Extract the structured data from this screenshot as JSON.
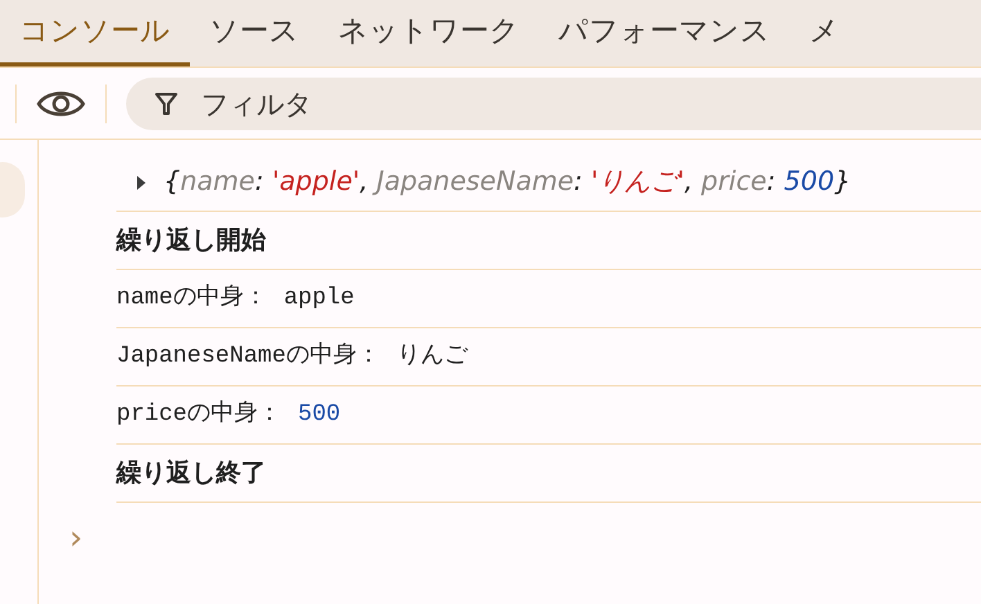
{
  "tabs": [
    {
      "label": "コンソール",
      "selected": true
    },
    {
      "label": "ソース",
      "selected": false
    },
    {
      "label": "ネットワーク",
      "selected": false
    },
    {
      "label": "パフォーマンス",
      "selected": false
    },
    {
      "label": "メ",
      "selected": false
    }
  ],
  "filter": {
    "placeholder": "フィルタ"
  },
  "entries": [
    {
      "kind": "object",
      "segments": [
        {
          "text": "{",
          "color": "#1f1f1f"
        },
        {
          "text": "name",
          "color": "#8a8580"
        },
        {
          "text": ": ",
          "color": "#1f1f1f"
        },
        {
          "text": "'apple'",
          "color": "#c5221f"
        },
        {
          "text": ", ",
          "color": "#1f1f1f"
        },
        {
          "text": "JapaneseName",
          "color": "#8a8580"
        },
        {
          "text": ": ",
          "color": "#1f1f1f"
        },
        {
          "text": "'りんご'",
          "color": "#c5221f"
        },
        {
          "text": ", ",
          "color": "#1f1f1f"
        },
        {
          "text": "price",
          "color": "#8a8580"
        },
        {
          "text": ": ",
          "color": "#1f1f1f"
        },
        {
          "text": "500",
          "color": "#1a4aa6"
        },
        {
          "text": "}",
          "color": "#1f1f1f"
        }
      ]
    },
    {
      "kind": "text",
      "text": "繰り返し開始"
    },
    {
      "kind": "pair",
      "label": "nameの中身：",
      "value": "apple",
      "color": "#1f1f1f"
    },
    {
      "kind": "pair",
      "label": "JapaneseNameの中身：",
      "value": "りんご",
      "color": "#1f1f1f"
    },
    {
      "kind": "pair",
      "label": "priceの中身：",
      "value": "500",
      "color": "#1a4aa6"
    },
    {
      "kind": "text",
      "text": "繰り返し終了"
    }
  ],
  "prompt": {
    "symbol": "›"
  }
}
